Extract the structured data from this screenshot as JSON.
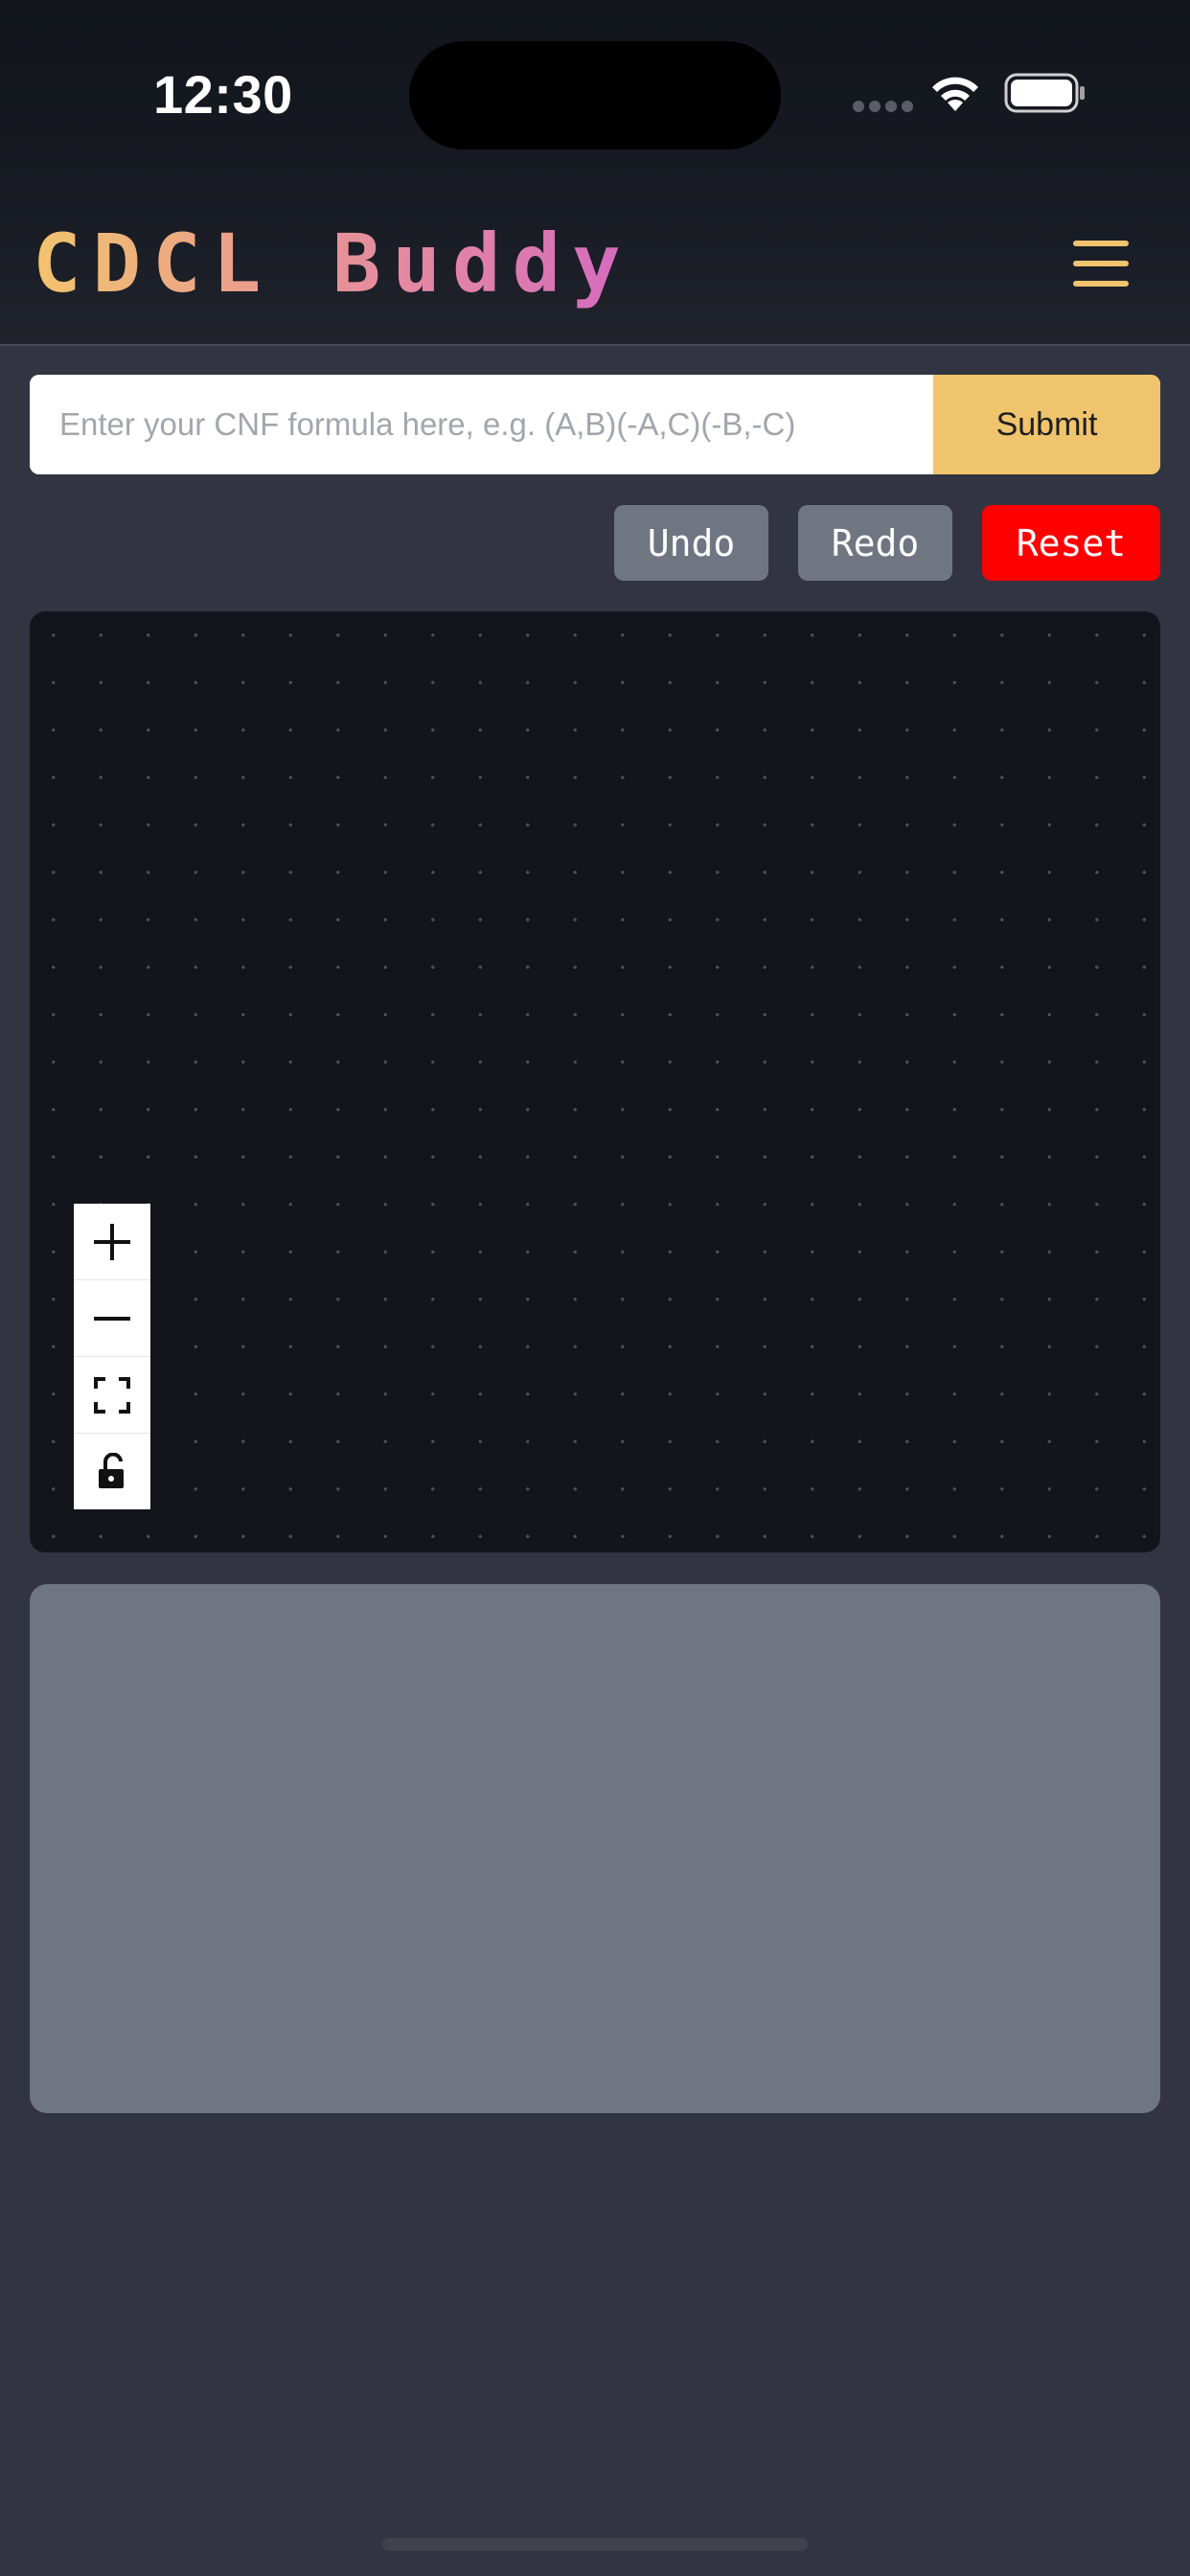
{
  "status_bar": {
    "time": "12:30",
    "icons": [
      "cellular-signal-icon",
      "wifi-icon",
      "battery-icon"
    ]
  },
  "header": {
    "brand": "CDCL Buddy",
    "menu_icon": "hamburger-menu-icon",
    "accent_color": "#efc46d"
  },
  "formula": {
    "value": "",
    "placeholder": "Enter your CNF formula here, e.g. (A,B)(-A,C)(-B,-C)",
    "submit_label": "Submit"
  },
  "actions": {
    "undo_label": "Undo",
    "redo_label": "Redo",
    "reset_label": "Reset"
  },
  "graph_controls": {
    "zoom_in": "plus-icon",
    "zoom_out": "minus-icon",
    "fit_view": "fit-view-icon",
    "lock": "unlock-icon"
  },
  "colors": {
    "background": "#323541",
    "canvas": "#13151c",
    "panel": "#707582",
    "reset": "#ff0000"
  }
}
